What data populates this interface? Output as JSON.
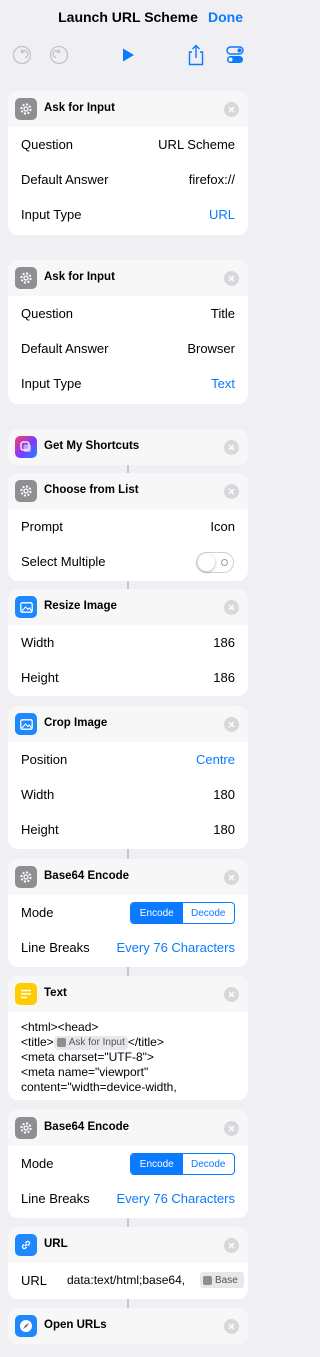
{
  "nav": {
    "title": "Launch URL Scheme",
    "done_label": "Done"
  },
  "colors": {
    "accent": "#0a7aff",
    "card_header": "#f7f7f7",
    "background": "#efeff4"
  },
  "actions": [
    {
      "title": "Ask for Input",
      "icon": "gear-icon",
      "rows": [
        {
          "label": "Question",
          "value": "URL Scheme"
        },
        {
          "label": "Default Answer",
          "value": "firefox://"
        },
        {
          "label": "Input Type",
          "value": "URL"
        }
      ]
    },
    {
      "title": "Ask for Input",
      "icon": "gear-icon",
      "rows": [
        {
          "label": "Question",
          "value": "Title"
        },
        {
          "label": "Default Answer",
          "value": "Browser"
        },
        {
          "label": "Input Type",
          "value": "Text"
        }
      ]
    },
    {
      "title": "Get My Shortcuts",
      "icon": "shortcuts-icon"
    },
    {
      "title": "Choose from List",
      "icon": "gear-icon",
      "rows": [
        {
          "label": "Prompt",
          "value": "Icon"
        },
        {
          "label": "Select Multiple",
          "value": false
        }
      ]
    },
    {
      "title": "Resize Image",
      "icon": "image-icon",
      "rows": [
        {
          "label": "Width",
          "value": "186"
        },
        {
          "label": "Height",
          "value": "186"
        }
      ]
    },
    {
      "title": "Crop Image",
      "icon": "image-icon",
      "rows": [
        {
          "label": "Position",
          "value": "Centre"
        },
        {
          "label": "Width",
          "value": "180"
        },
        {
          "label": "Height",
          "value": "180"
        }
      ]
    },
    {
      "title": "Base64 Encode",
      "icon": "gear-icon",
      "rows": [
        {
          "label": "Mode",
          "options": [
            "Encode",
            "Decode"
          ],
          "selected": "Encode"
        },
        {
          "label": "Line Breaks",
          "value": "Every 76 Characters"
        }
      ]
    },
    {
      "title": "Text",
      "icon": "text-icon",
      "text": {
        "line1": "<html><head>",
        "line2_pre": "<title>",
        "token": "Ask for Input",
        "line2_post": "</title>",
        "line3": "<meta charset=\"UTF-8\">",
        "line4": "<meta name=\"viewport\"",
        "line5": "content=\"width=device-width,"
      }
    },
    {
      "title": "Base64 Encode",
      "icon": "gear-icon",
      "rows": [
        {
          "label": "Mode",
          "options": [
            "Encode",
            "Decode"
          ],
          "selected": "Encode"
        },
        {
          "label": "Line Breaks",
          "value": "Every 76 Characters"
        }
      ]
    },
    {
      "title": "URL",
      "icon": "link-icon",
      "rows": [
        {
          "label": "URL",
          "value": "data:text/html;base64,",
          "token": "Base"
        }
      ]
    },
    {
      "title": "Open URLs",
      "icon": "compass-icon"
    }
  ]
}
